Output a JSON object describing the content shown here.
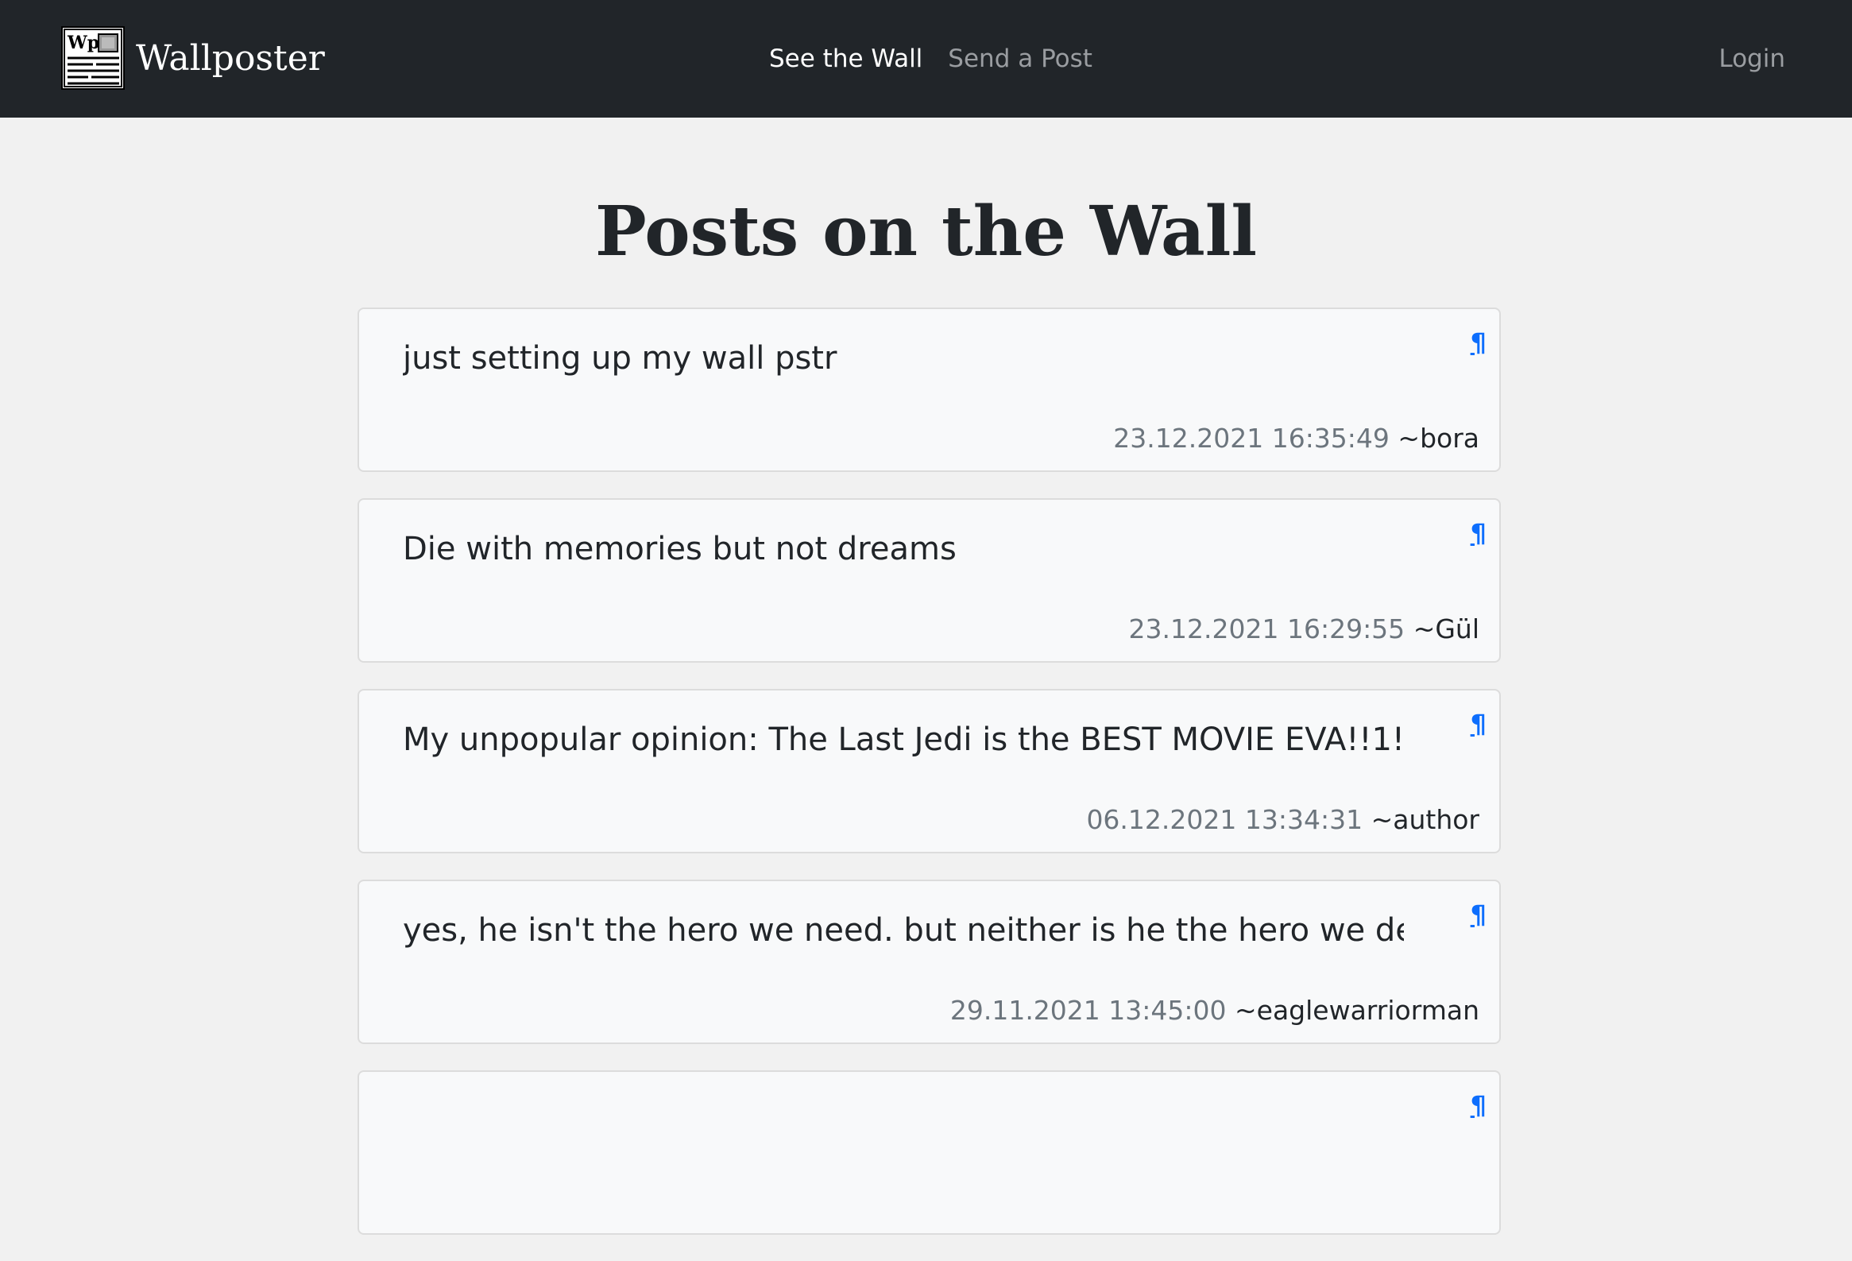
{
  "brand": {
    "name": "Wallposter",
    "logo_text": "Wp"
  },
  "nav": {
    "items": [
      {
        "label": "See the Wall"
      },
      {
        "label": "Send a Post"
      }
    ],
    "login_label": "Login"
  },
  "page": {
    "title": "Posts on the Wall"
  },
  "posts": [
    {
      "text": "just setting up my wall pstr",
      "date": "23.12.2021 16:35:49",
      "author": "~bora",
      "permalink": "¶"
    },
    {
      "text": "Die with memories but not dreams",
      "date": "23.12.2021 16:29:55",
      "author": "~Gül",
      "permalink": "¶"
    },
    {
      "text": "My unpopular opinion: The Last Jedi is the BEST MOVIE EVA!!1!",
      "date": "06.12.2021 13:34:31",
      "author": "~author",
      "permalink": "¶"
    },
    {
      "text": "yes, he isn't the hero we need. but neither is he the hero we deserve",
      "date": "29.11.2021 13:45:00",
      "author": "~eaglewarriorman",
      "permalink": "¶"
    },
    {
      "text": "",
      "date": "",
      "author": "",
      "permalink": "¶"
    }
  ],
  "colors": {
    "navbar": "#212529",
    "background": "#f1f1f1",
    "card": "#f8f9fa",
    "link": "#0d6efd",
    "muted": "#6c757d"
  }
}
